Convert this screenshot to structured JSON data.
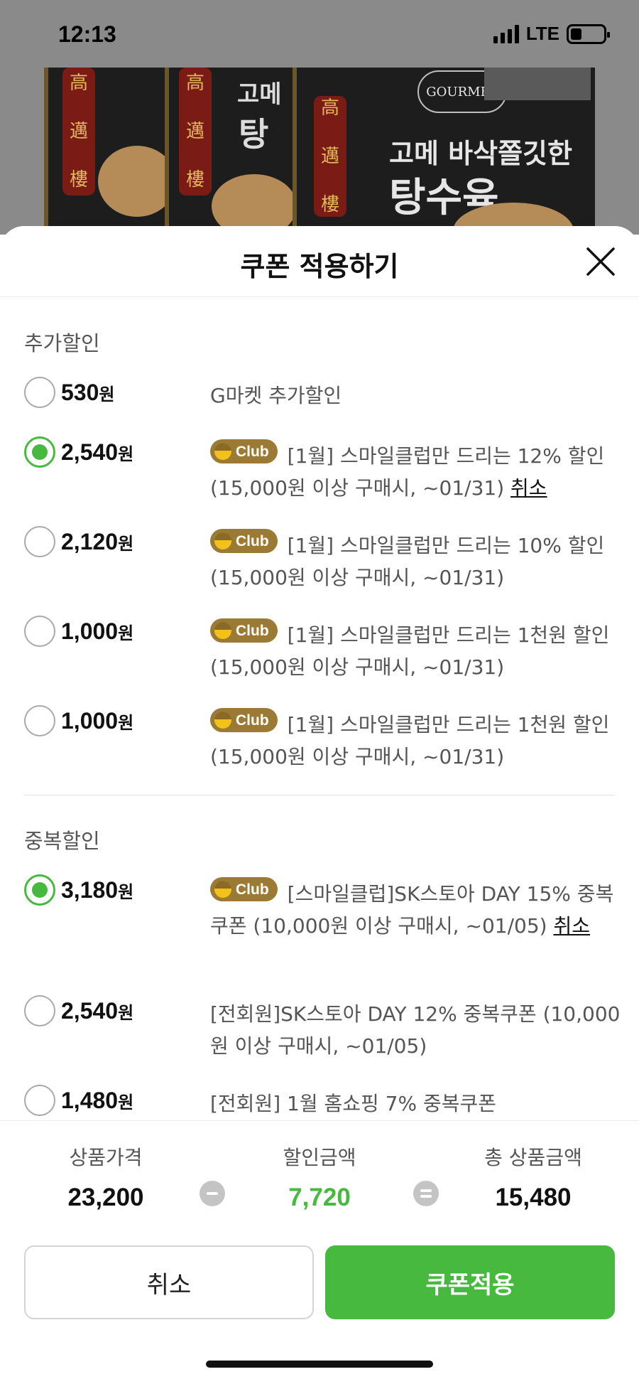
{
  "status_bar": {
    "time": "12:13",
    "network": "LTE",
    "battery_level": 0.35
  },
  "background": {
    "image_title_line1": "고메 바삭쫄깃한",
    "image_title_line2": "탕수육",
    "brand": "GOURMET",
    "side_text_1": "고메",
    "side_text_2": "탕",
    "lantern_chars": "高邁樓"
  },
  "sheet": {
    "title": "쿠폰 적용하기"
  },
  "club_badge_label": "Club",
  "sections": {
    "extra": {
      "label": "추가할인",
      "items": [
        {
          "amount": "530",
          "unit": "원",
          "desc": "G마켓 추가할인",
          "selected": false
        },
        {
          "amount": "2,540",
          "unit": "원",
          "desc": "[1월] 스마일클럽만 드리는 12% 할인 (15,000원 이상 구매시, ~01/31)",
          "cancel": "취소",
          "selected": true
        },
        {
          "amount": "2,120",
          "unit": "원",
          "desc": "[1월] 스마일클럽만 드리는 10% 할인 (15,000원 이상 구매시, ~01/31)",
          "selected": false
        },
        {
          "amount": "1,000",
          "unit": "원",
          "desc": "[1월] 스마일클럽만 드리는 1천원 할인 (15,000원 이상 구매시, ~01/31)",
          "selected": false
        },
        {
          "amount": "1,000",
          "unit": "원",
          "desc": "[1월] 스마일클럽만 드리는 1천원 할인 (15,000원 이상 구매시, ~01/31)",
          "selected": false
        }
      ]
    },
    "duplicate": {
      "label": "중복할인",
      "items": [
        {
          "amount": "3,180",
          "unit": "원",
          "desc": "[스마일클럽]SK스토아 DAY 15% 중복쿠폰 (10,000원 이상 구매시, ~01/05)",
          "cancel": "취소",
          "selected": true
        },
        {
          "amount": "2,540",
          "unit": "원",
          "desc": "[전회원]SK스토아 DAY 12% 중복쿠폰 (10,000원 이상 구매시, ~01/05)",
          "selected": false
        },
        {
          "amount": "1,480",
          "unit": "원",
          "desc": "[전회원] 1월 홈쇼핑 7% 중복쿠폰",
          "selected": false
        }
      ]
    }
  },
  "summary": {
    "price_label": "상품가격",
    "price_value": "23,200",
    "discount_label": "할인금액",
    "discount_value": "7,720",
    "total_label": "총 상품금액",
    "total_value": "15,480"
  },
  "buttons": {
    "cancel": "취소",
    "apply": "쿠폰적용"
  },
  "colors": {
    "accent": "#47b93e",
    "club_badge": "#9a7a34",
    "overlay": "#8a8a8a"
  }
}
